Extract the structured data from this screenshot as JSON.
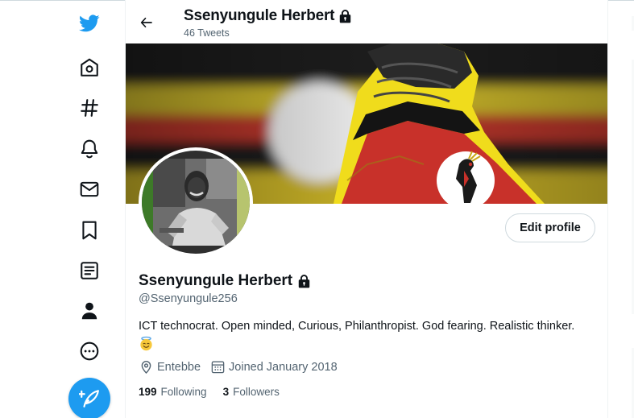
{
  "header": {
    "name": "Ssenyungule Herbert",
    "tweet_count": "46 Tweets"
  },
  "nav": {
    "items": [
      {
        "icon": "twitter-logo-icon"
      },
      {
        "icon": "home-icon"
      },
      {
        "icon": "explore-hashtag-icon"
      },
      {
        "icon": "notifications-bell-icon"
      },
      {
        "icon": "messages-envelope-icon"
      },
      {
        "icon": "bookmarks-icon"
      },
      {
        "icon": "lists-icon"
      },
      {
        "icon": "profile-person-icon"
      },
      {
        "icon": "more-icon"
      },
      {
        "icon": "compose-tweet-icon"
      }
    ]
  },
  "profile": {
    "name": "Ssenyungule Herbert",
    "handle": "@Ssenyungule256",
    "bio": "ICT technocrat. Open minded, Curious, Philanthropist. God fearing. Realistic thinker.",
    "bio_emoji": "😇",
    "location": "Entebbe",
    "joined": "Joined January 2018",
    "following_count": "199",
    "following_label": "Following",
    "followers_count": "3",
    "followers_label": "Followers",
    "edit_button": "Edit profile"
  },
  "colors": {
    "accent": "#1d9bf0",
    "text": "#0f1419",
    "muted": "#536471",
    "border": "#cfd9de"
  }
}
